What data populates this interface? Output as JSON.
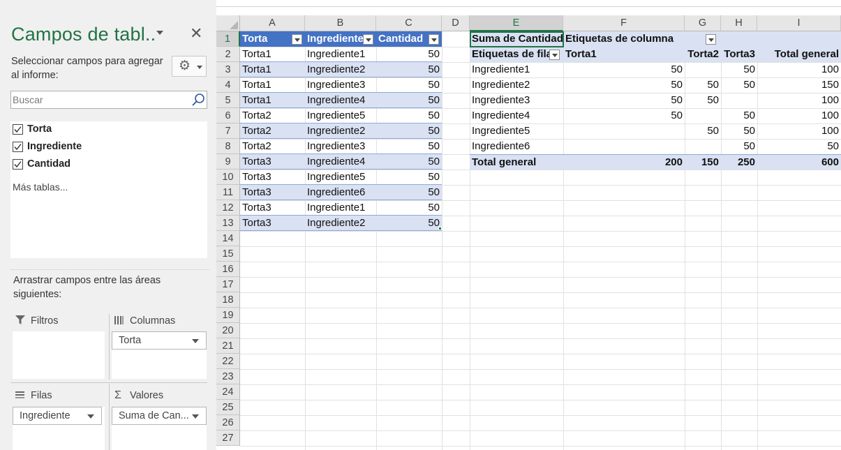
{
  "pane": {
    "title": "Campos de tabl..",
    "subtitle": "Seleccionar campos para agregar al informe:",
    "gear_icon": "gear-icon",
    "search_placeholder": "Buscar",
    "fields": [
      {
        "label": "Torta",
        "checked": true
      },
      {
        "label": "Ingrediente",
        "checked": true
      },
      {
        "label": "Cantidad",
        "checked": true
      }
    ],
    "more_tables": "Más tablas...",
    "drag_hint": "Arrastrar campos entre las áreas siguientes:",
    "areas": {
      "filters": {
        "label": "Filtros",
        "icon": "filter-icon",
        "fields": []
      },
      "columns": {
        "label": "Columnas",
        "icon": "columns-icon",
        "fields": [
          "Torta"
        ]
      },
      "rows": {
        "label": "Filas",
        "icon": "rows-icon",
        "fields": [
          "Ingrediente"
        ]
      },
      "values": {
        "label": "Valores",
        "icon": "sigma-icon",
        "fields": [
          "Suma de Can..."
        ]
      }
    }
  },
  "sheet": {
    "columns": [
      "A",
      "B",
      "C",
      "D",
      "E",
      "F",
      "G",
      "H",
      "I"
    ],
    "selected_column": "E",
    "rows": [
      "1",
      "2",
      "3",
      "4",
      "5",
      "6",
      "7",
      "8",
      "9",
      "10",
      "11",
      "12",
      "13",
      "14",
      "15",
      "16",
      "17",
      "18",
      "19",
      "20",
      "21",
      "22",
      "23",
      "24",
      "25",
      "26",
      "27"
    ],
    "selected_row": "1",
    "table": {
      "headers": [
        "Torta",
        "Ingrediente",
        "Cantidad"
      ],
      "rows": [
        [
          "Torta1",
          "Ingrediente1",
          "50"
        ],
        [
          "Torta1",
          "Ingrediente2",
          "50"
        ],
        [
          "Torta1",
          "Ingrediente3",
          "50"
        ],
        [
          "Torta1",
          "Ingrediente4",
          "50"
        ],
        [
          "Torta2",
          "Ingrediente5",
          "50"
        ],
        [
          "Torta2",
          "Ingrediente2",
          "50"
        ],
        [
          "Torta2",
          "Ingrediente3",
          "50"
        ],
        [
          "Torta3",
          "Ingrediente4",
          "50"
        ],
        [
          "Torta3",
          "Ingrediente5",
          "50"
        ],
        [
          "Torta3",
          "Ingrediente6",
          "50"
        ],
        [
          "Torta3",
          "Ingrediente1",
          "50"
        ],
        [
          "Torta3",
          "Ingrediente2",
          "50"
        ]
      ]
    },
    "pivot": {
      "sum_label": "Suma de Cantidad",
      "col_labels": "Etiquetas de columna",
      "row_labels": "Etiquetas de fila",
      "col_headers": [
        "Torta1",
        "Torta2",
        "Torta3",
        "Total general"
      ],
      "rows": [
        {
          "label": "Ingrediente1",
          "values": [
            "50",
            "",
            "50",
            "100"
          ]
        },
        {
          "label": "Ingrediente2",
          "values": [
            "50",
            "50",
            "50",
            "150"
          ]
        },
        {
          "label": "Ingrediente3",
          "values": [
            "50",
            "50",
            "",
            "100"
          ]
        },
        {
          "label": "Ingrediente4",
          "values": [
            "50",
            "",
            "50",
            "100"
          ]
        },
        {
          "label": "Ingrediente5",
          "values": [
            "",
            "50",
            "50",
            "100"
          ]
        },
        {
          "label": "Ingrediente6",
          "values": [
            "",
            "",
            "50",
            "50"
          ]
        }
      ],
      "total": {
        "label": "Total general",
        "values": [
          "200",
          "150",
          "250",
          "600"
        ]
      }
    }
  }
}
